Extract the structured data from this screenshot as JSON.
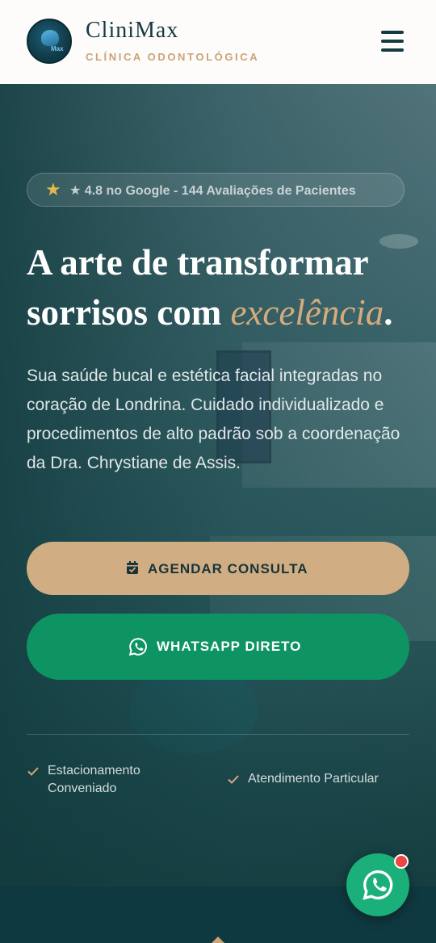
{
  "header": {
    "brand_name": "CliniMax",
    "brand_subtitle": "CLÍNICA ODONTOLÓGICA",
    "logo_mark_text": "Max"
  },
  "hero": {
    "rating_text": "★ 4.8 no Google - 144 Avaliações de Pacientes",
    "headline_line1": "A arte de transformar",
    "headline_line2_prefix": "sorrisos com ",
    "headline_accent": "excelência",
    "headline_suffix": ".",
    "lead": "Sua saúde bucal e estética facial integradas no coração de Londrina. Cuidado individualizado e procedimentos de alto padrão sob a coordenação da Dra. Chrystiane de Assis.",
    "primary_button_label": "AGENDAR CONSULTA",
    "whatsapp_button_label": "WHATSAPP DIRETO",
    "features": [
      {
        "label": "Estacionamento Conveniado"
      },
      {
        "label": "Atendimento Particular"
      }
    ]
  },
  "icons": {
    "rating": "star-icon",
    "primary_button": "calendar-check-icon",
    "whatsapp_button": "whatsapp-icon",
    "feature": "check-icon",
    "menu": "hamburger-menu-icon",
    "fab": "whatsapp-icon"
  },
  "colors": {
    "brand_dark": "#163a44",
    "gold": "#c9a477",
    "primary_button": "#d0ad82",
    "whatsapp_green": "#0e9463",
    "fab_green": "#1bb07a",
    "notification": "#ee4545"
  }
}
